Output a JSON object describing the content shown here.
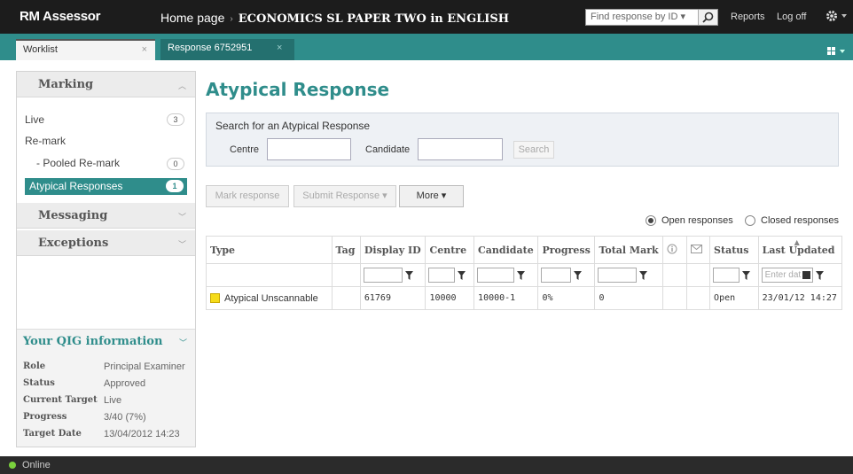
{
  "app": {
    "brand": "RM Assessor"
  },
  "header": {
    "breadcrumb_home": "Home page",
    "breadcrumb_sep": "›",
    "breadcrumb_paper": "ECONOMICS SL PAPER TWO in ENGLISH",
    "find_placeholder": "Find response by ID ▾",
    "reports": "Reports",
    "logoff": "Log off"
  },
  "tabs": [
    {
      "label": "Worklist",
      "close": "×"
    },
    {
      "label": "Response 6752951",
      "close": "×"
    }
  ],
  "sidebar": {
    "marking": "Marking",
    "items": {
      "live": {
        "label": "Live",
        "count": "3"
      },
      "remark": {
        "label": "Re-mark"
      },
      "pooled": {
        "label": "- Pooled Re-mark",
        "count": "0"
      },
      "atypical": {
        "label": "Atypical Responses",
        "count": "1"
      }
    },
    "messaging": "Messaging",
    "exceptions": "Exceptions",
    "qig": {
      "title": "Your QIG information",
      "rows": [
        {
          "key": "Role",
          "value": "Principal Examiner"
        },
        {
          "key": "Status",
          "value": "Approved"
        },
        {
          "key": "Current Target",
          "value": "Live"
        },
        {
          "key": "Progress",
          "value": "3/40 (7%)"
        },
        {
          "key": "Target Date",
          "value": "13/04/2012 14:23"
        }
      ]
    }
  },
  "main": {
    "title": "Atypical Response",
    "search": {
      "caption": "Search for an Atypical Response",
      "centre_label": "Centre",
      "candidate_label": "Candidate",
      "search_button": "Search"
    },
    "actions": {
      "mark": "Mark response",
      "submit": "Submit Response ▾",
      "more": "More ▾"
    },
    "filter": {
      "open": "Open responses",
      "closed": "Closed responses"
    },
    "table": {
      "headers": [
        "Type",
        "Tag",
        "Display ID",
        "Centre",
        "Candidate",
        "Progress",
        "Total Mark",
        "",
        "",
        "Status",
        "Last Updated"
      ],
      "date_placeholder": "Enter dat",
      "rows": [
        {
          "type": "Atypical Unscannable",
          "tag": "",
          "display_id": "61769",
          "centre": "10000",
          "candidate": "10000-1",
          "progress": "0%",
          "total_mark": "0",
          "status": "Open",
          "last_updated": "23/01/12 14:27"
        }
      ]
    }
  },
  "statusbar": {
    "label": "Online"
  },
  "colors": {
    "accent": "#2f8d8b",
    "topbar": "#1c1c1c",
    "status_online": "#7ad13d",
    "type_marker": "#f6dc1a"
  }
}
